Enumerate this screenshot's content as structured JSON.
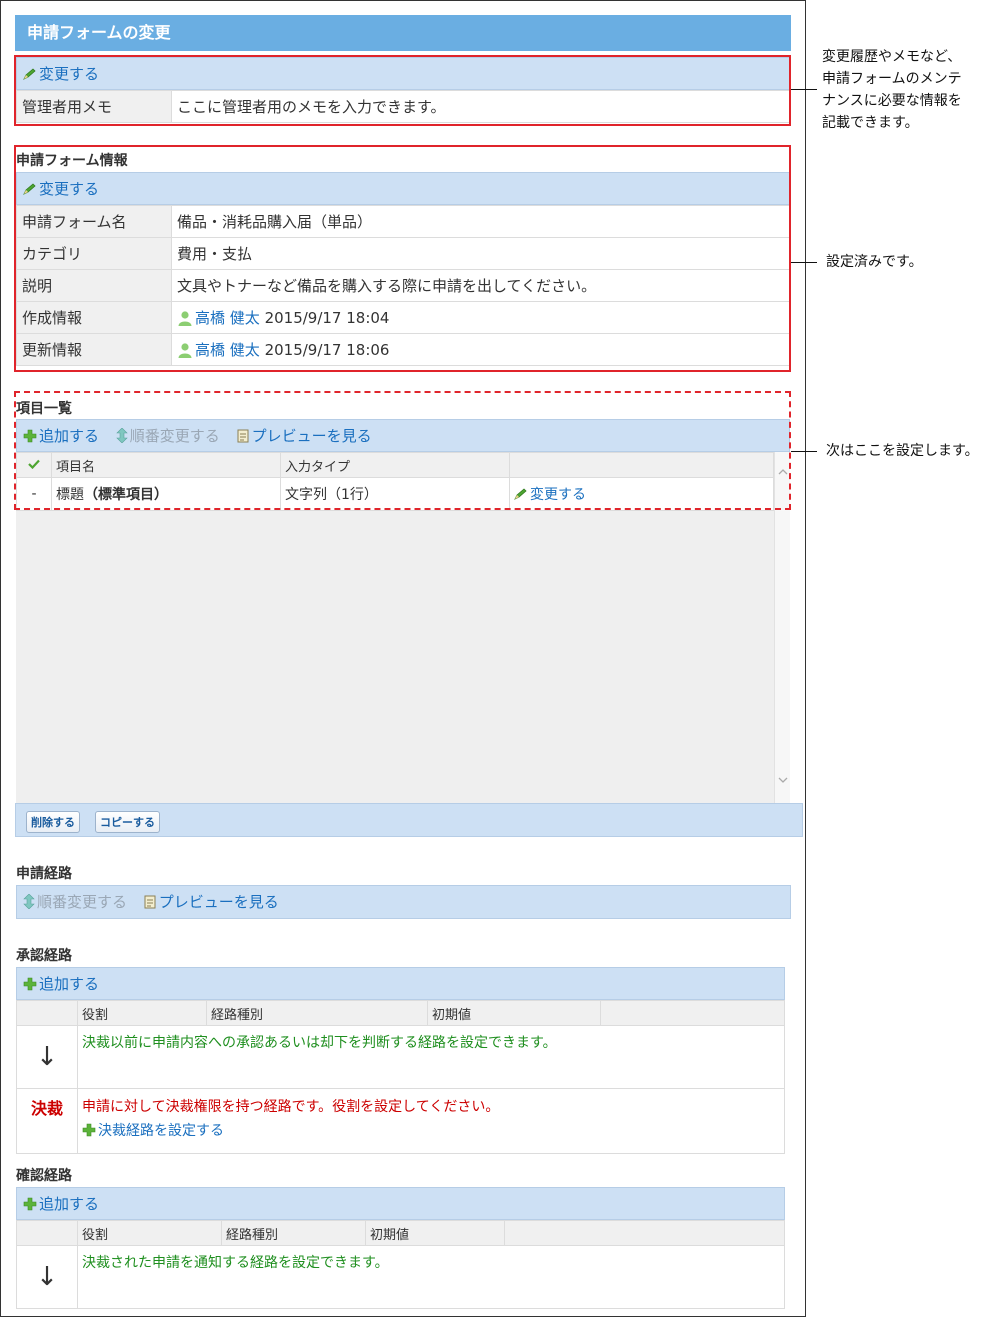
{
  "page": {
    "title": "申請フォームの変更"
  },
  "memo_section": {
    "change_link": "変更する",
    "label": "管理者用メモ",
    "value": "ここに管理者用のメモを入力できます。"
  },
  "form_info": {
    "heading": "申請フォーム情報",
    "change_link": "変更する",
    "rows": [
      {
        "label": "申請フォーム名",
        "value": "備品・消耗品購入届（単品）"
      },
      {
        "label": "カテゴリ",
        "value": "費用・支払"
      },
      {
        "label": "説明",
        "value": "文具やトナーなど備品を購入する際に申請を出してください。"
      }
    ],
    "created": {
      "label": "作成情報",
      "user": "高橋 健太",
      "datetime": "2015/9/17 18:04"
    },
    "updated": {
      "label": "更新情報",
      "user": "高橋 健太",
      "datetime": "2015/9/17 18:06"
    }
  },
  "items": {
    "heading": "項目一覧",
    "add": "追加する",
    "reorder": "順番変更する",
    "preview": "プレビューを見る",
    "columns": {
      "name": "項目名",
      "type": "入力タイプ"
    },
    "row": {
      "dash": "-",
      "name": "標題",
      "name_suffix": "（標準項目）",
      "type": "文字列（1行）",
      "change": "変更する"
    },
    "delete_button": "削除する",
    "copy_button": "コピーする"
  },
  "route": {
    "heading": "申請経路",
    "reorder": "順番変更する",
    "preview": "プレビューを見る"
  },
  "approval": {
    "heading": "承認経路",
    "add": "追加する",
    "columns": {
      "role": "役割",
      "route_type": "経路種別",
      "initial": "初期値"
    },
    "arrow": "↓",
    "info": "決裁以前に申請内容への承認あるいは却下を判断する経路を設定できます。",
    "decision_stamp": "決裁",
    "decision_text": "申請に対して決裁権限を持つ経路です。役割を設定してください。",
    "decision_link": "決裁経路を設定する"
  },
  "confirm": {
    "heading": "確認経路",
    "add": "追加する",
    "columns": {
      "role": "役割",
      "route_type": "経路種別",
      "initial": "初期値"
    },
    "arrow": "↓",
    "info": "決裁された申請を通知する経路を設定できます。"
  },
  "annotations": {
    "note1_lines": [
      "変更履歴やメモなど、",
      "申請フォームのメンテ",
      "ナンスに必要な情報を",
      "記載できます。"
    ],
    "note2": "設定済みです。",
    "note3": "次はここを設定します。"
  },
  "colors": {
    "title_bar": "#6aaee2",
    "toolbar": "#cde0f4",
    "link": "#1a6fbf",
    "highlight": "#e0242b",
    "info_green": "#1f8f1f",
    "decision_red": "#cc0000"
  },
  "icons": [
    "pencil-icon",
    "plus-icon",
    "updown-icon",
    "document-icon",
    "user-icon",
    "check-icon",
    "down-arrow-icon",
    "decision-stamp-icon"
  ]
}
